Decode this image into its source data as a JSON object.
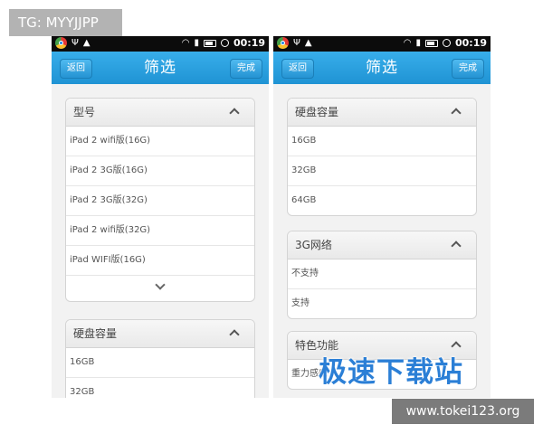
{
  "watermarks": {
    "tag": "TG: MYYJJPP",
    "brand": "极速下载站",
    "url": "www.tokei123.org"
  },
  "status_bar": {
    "time": "00:19"
  },
  "colors": {
    "accent": "#2ba0df",
    "status_bar": "#0c0c0c",
    "watermark_brand": "#2b7fd6"
  },
  "left_screen": {
    "title": "筛选",
    "back_label": "返回",
    "done_label": "完成",
    "model_section": {
      "header": "型号",
      "options": [
        "iPad 2 wifi版(16G)",
        "iPad 2 3G版(16G)",
        "iPad 2 3G版(32G)",
        "iPad 2 wifi版(32G)",
        "iPad WIFI版(16G)"
      ]
    },
    "storage_section": {
      "header": "硬盘容量",
      "options": [
        "16GB",
        "32GB"
      ]
    }
  },
  "right_screen": {
    "title": "筛选",
    "back_label": "返回",
    "done_label": "完成",
    "storage_section": {
      "header": "硬盘容量",
      "options": [
        "16GB",
        "32GB",
        "64GB"
      ]
    },
    "network_section": {
      "header": "3G网络",
      "options": [
        "不支持",
        "支持"
      ]
    },
    "feature_section": {
      "header": "特色功能",
      "options": [
        "重力感应"
      ]
    }
  }
}
